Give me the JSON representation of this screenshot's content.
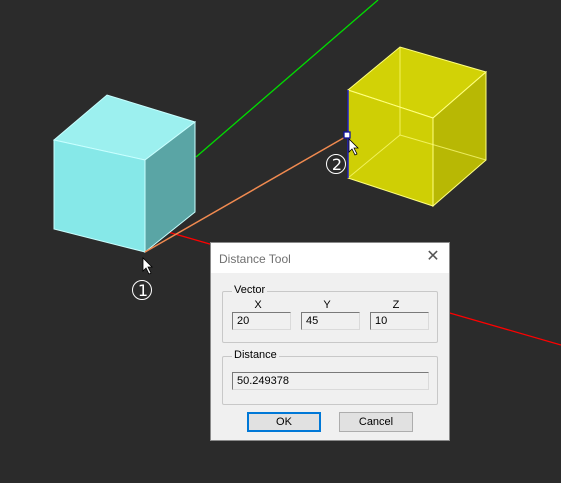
{
  "dialog": {
    "title": "Distance Tool",
    "vector_label": "Vector",
    "columns": [
      "X",
      "Y",
      "Z"
    ],
    "vector": {
      "x": "20",
      "y": "45",
      "z": "10"
    },
    "distance_label": "Distance",
    "distance": "50.249378",
    "ok_label": "OK",
    "cancel_label": "Cancel"
  },
  "markers": {
    "first": "1",
    "second": "2"
  },
  "colors": {
    "background": "#2b2b2b",
    "cyan_cube": "#86e8e8",
    "yellow_cube": "#f0f000",
    "measure_line": "#f08a50",
    "axis_x": "#ff0000",
    "axis_y": "#00dd00"
  },
  "icons": [
    "close-icon",
    "cursor-arrow-icon",
    "point-handle-icon"
  ]
}
